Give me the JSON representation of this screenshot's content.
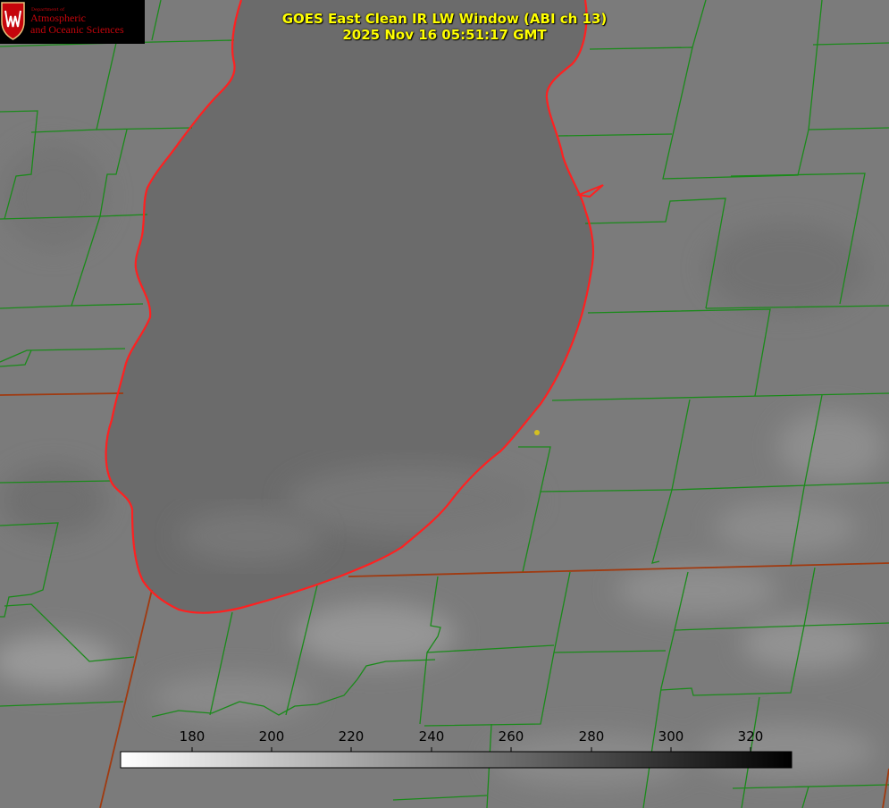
{
  "logo": {
    "department_line": "Department of",
    "name_line1": "Atmospheric",
    "name_line2": "and Oceanic Sciences",
    "seal_icon": "uw-crest-icon",
    "colors": {
      "text": "#c5050c",
      "background": "#000000"
    }
  },
  "header": {
    "title": "GOES East Clean IR LW Window (ABI ch 13)",
    "timestamp": "2025 Nov 16 05:51:17 GMT",
    "color": "#ffff00"
  },
  "colorbar": {
    "ticks": [
      "180",
      "200",
      "220",
      "240",
      "260",
      "280",
      "300",
      "320"
    ],
    "range_min": 160,
    "range_max": 330,
    "gradient": [
      "#ffffff",
      "#000000"
    ]
  },
  "map": {
    "county_line_color": "#1a8a1a",
    "state_line_color": "#a03010",
    "lake_shore_color": "#ff2020",
    "marker_color": "#d4c020",
    "lake_shade": "#6c6c6c",
    "land_shade": "#7c7c7c"
  }
}
